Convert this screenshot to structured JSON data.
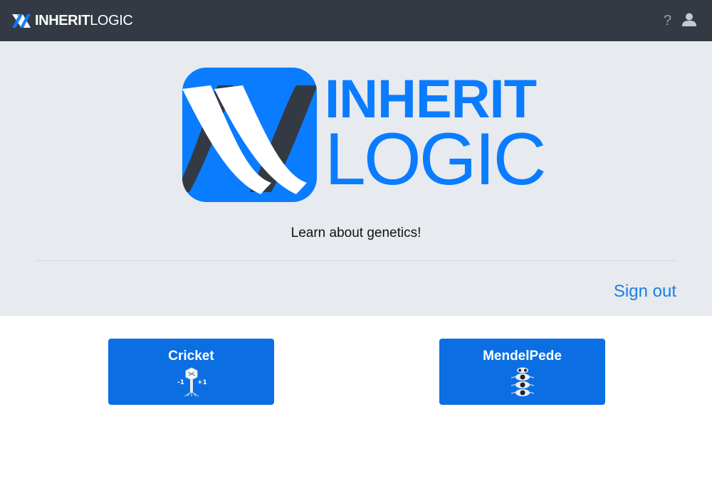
{
  "header": {
    "brand_bold": "INHERIT",
    "brand_light": "LOGIC",
    "help_label": "?",
    "bg_color": "#343a44"
  },
  "hero": {
    "logo_word1": "INHERIT",
    "logo_word2": "LOGIC",
    "tagline": "Learn about genetics!",
    "signout_label": "Sign out",
    "accent_color": "#0a7cff",
    "bg_color": "#e7eaee"
  },
  "games": [
    {
      "title": "Cricket",
      "icon": "bacteriophage-icon"
    },
    {
      "title": "MendelPede",
      "icon": "mendelpede-icon"
    }
  ],
  "colors": {
    "card": "#0b6fe3",
    "link": "#1a7ee8"
  }
}
